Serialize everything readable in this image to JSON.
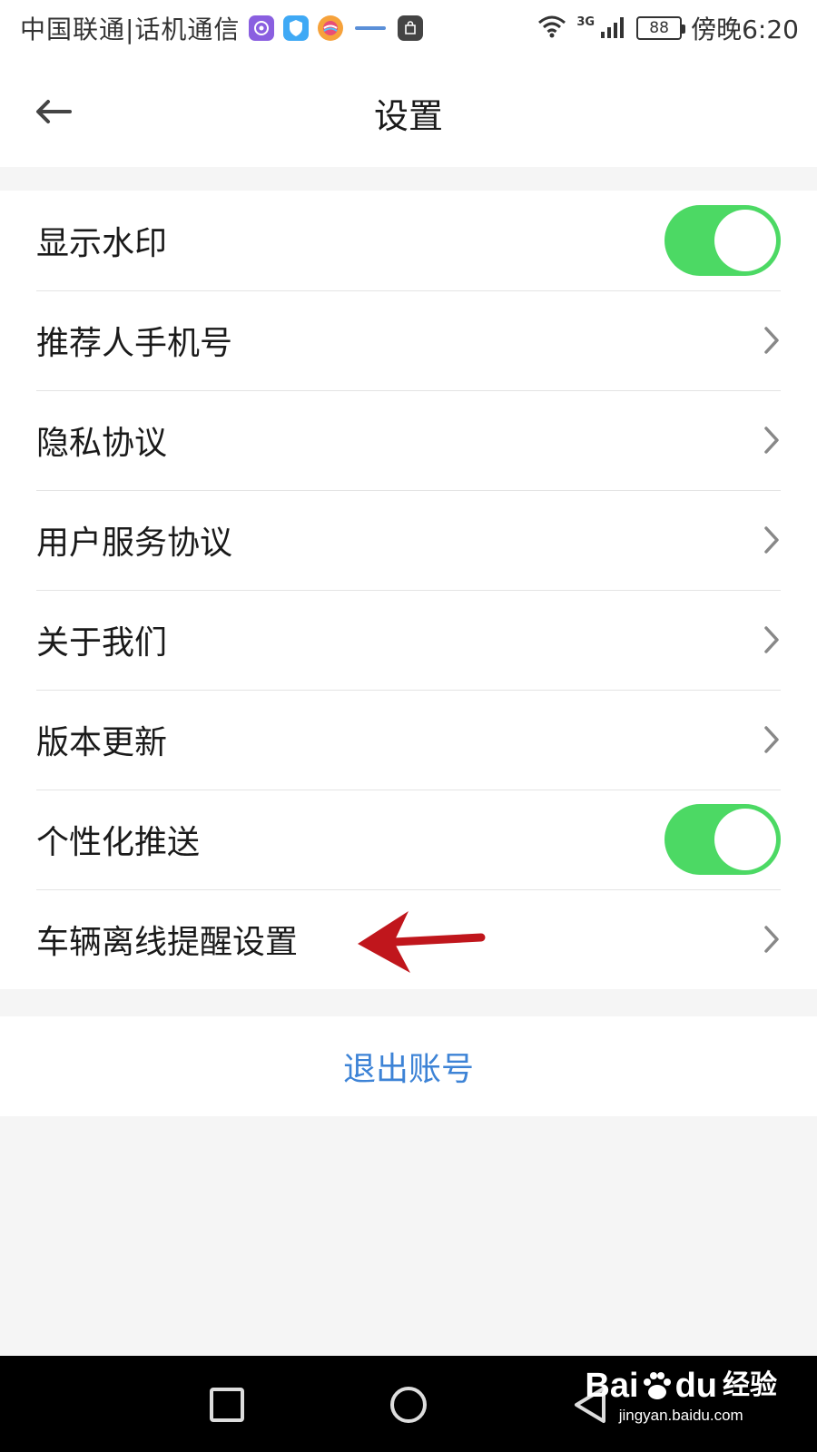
{
  "status_bar": {
    "carrier": "中国联通|话机通信",
    "network_label": "3G",
    "battery_level": "88",
    "time": "傍晚6:20"
  },
  "header": {
    "title": "设置"
  },
  "settings": {
    "items": [
      {
        "label": "显示水印",
        "control": "toggle",
        "on": true
      },
      {
        "label": "推荐人手机号",
        "control": "chevron"
      },
      {
        "label": "隐私协议",
        "control": "chevron"
      },
      {
        "label": "用户服务协议",
        "control": "chevron"
      },
      {
        "label": "关于我们",
        "control": "chevron"
      },
      {
        "label": "版本更新",
        "control": "chevron"
      },
      {
        "label": "个性化推送",
        "control": "toggle",
        "on": true
      },
      {
        "label": "车辆离线提醒设置",
        "control": "chevron"
      }
    ]
  },
  "logout": {
    "label": "退出账号"
  },
  "watermark": {
    "brand": "Bai",
    "brand_suffix": "du",
    "brand_cn": "经验",
    "url": "jingyan.baidu.com"
  },
  "colors": {
    "toggle_on": "#4cd964",
    "link_blue": "#3d83d6",
    "annotation_red": "#c0161c",
    "nav_bar": "#000000"
  }
}
